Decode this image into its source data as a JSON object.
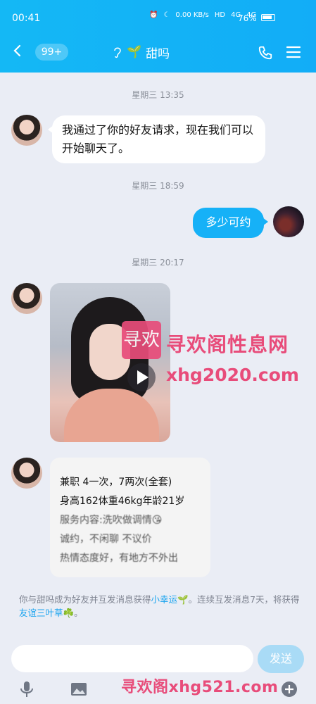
{
  "status_bar": {
    "time": "00:41",
    "net_speed": "0.00\nKB/s",
    "signal1": "HD",
    "signal2": "4G",
    "signal3": "4G",
    "battery": "76%"
  },
  "header": {
    "unread_badge": "99+",
    "contact_name": "甜吗",
    "contact_leaf": "🌱"
  },
  "messages": [
    {
      "time": "星期三 13:35",
      "text": "我通过了你的好友请求，现在我们可以开始聊天了。"
    },
    {
      "time": "星期三 18:59",
      "text": "多少可约"
    },
    {
      "time": "星期三 20:17"
    }
  ],
  "card": {
    "lines": [
      "兼职 4一次，7两次(全套)",
      "身高162体重46kg年龄21岁",
      "服务内容:洗吹做调情😘",
      "诚约，不闲聊 不议价",
      "热情态度好，有地方不外出"
    ]
  },
  "system_note": {
    "part1": "你与甜吗成为好友并互发消息获得",
    "link1": "小幸运🌱",
    "part2": "。连续互发消息7天，将获得",
    "link2": "友谊三叶草☘️",
    "part3": "。"
  },
  "input": {
    "placeholder": "",
    "send_label": "发送"
  },
  "watermarks": {
    "box": "寻欢",
    "line1": "寻欢阁性息网",
    "line2": "xhg2020.com",
    "bottom": "寻欢阁xhg521.com"
  }
}
